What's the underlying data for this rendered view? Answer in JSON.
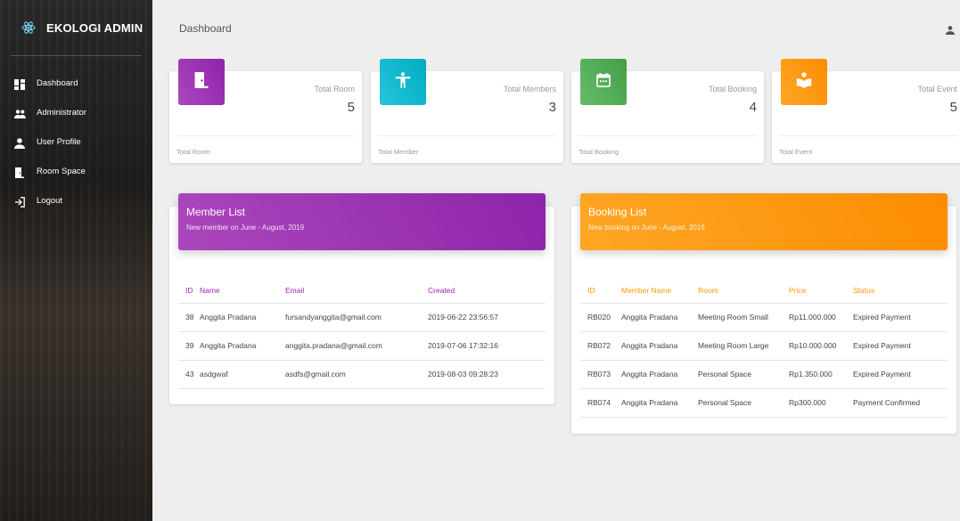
{
  "brand": {
    "title": "EKOLOGI ADMIN",
    "logo_icon": "atom-icon",
    "color": "#7fd6ff"
  },
  "sidebar": {
    "items": [
      {
        "label": "Dashboard",
        "icon": "dashboard-icon"
      },
      {
        "label": "Administrator",
        "icon": "people-icon"
      },
      {
        "label": "User Profile",
        "icon": "person-icon"
      },
      {
        "label": "Room Space",
        "icon": "door-icon"
      },
      {
        "label": "Logout",
        "icon": "logout-icon"
      }
    ]
  },
  "header": {
    "title": "Dashboard",
    "user_icon": "person-icon"
  },
  "stats": [
    {
      "category": "Total Room",
      "value": "5",
      "footer": "Total Room",
      "color": "#ab47bc",
      "icon": "door-icon"
    },
    {
      "category": "Total Members",
      "value": "3",
      "footer": "Total Member",
      "color": "#26c6da",
      "icon": "person-standing-icon"
    },
    {
      "category": "Total Booking",
      "value": "4",
      "footer": "Total Booking",
      "color": "#66bb6a",
      "icon": "calendar-icon"
    },
    {
      "category": "Total Event",
      "value": "5",
      "footer": "Total Event",
      "color": "#ffa726",
      "icon": "book-icon"
    }
  ],
  "member_list": {
    "title": "Member List",
    "subtitle": "New member on June - August, 2019",
    "color": "#ab47bc",
    "columns": {
      "id": "ID",
      "name": "Name",
      "email": "Email",
      "created": "Created"
    },
    "rows": [
      {
        "id": "38",
        "name": "Anggita Pradana",
        "email": "fursandyanggita@gmail.com",
        "created": "2019-06-22 23:56:57"
      },
      {
        "id": "39",
        "name": "Anggita Pradana",
        "email": "anggita.pradana@gmail.com",
        "created": "2019-07-06 17:32:16"
      },
      {
        "id": "43",
        "name": "asdgwaf",
        "email": "asdfs@gmail.com",
        "created": "2019-08-03 09:28:23"
      }
    ]
  },
  "booking_list": {
    "title": "Booking List",
    "subtitle": "New booking on June - August, 2019",
    "color": "#ffa726",
    "columns": {
      "id": "ID",
      "member": "Member Name",
      "room": "Room",
      "price": "Price",
      "status": "Status"
    },
    "rows": [
      {
        "id": "RB020",
        "member": "Anggita Pradana",
        "room": "Meeting Room Small",
        "price": "Rp11.000.000",
        "status": "Expired Payment"
      },
      {
        "id": "RB072",
        "member": "Anggita Pradana",
        "room": "Meeting Room Large",
        "price": "Rp10.000.000",
        "status": "Expired Payment"
      },
      {
        "id": "RB073",
        "member": "Anggita Pradana",
        "room": "Personal Space",
        "price": "Rp1.350.000",
        "status": "Expired Payment"
      },
      {
        "id": "RB074",
        "member": "Anggita Pradana",
        "room": "Personal Space",
        "price": "Rp300.000",
        "status": "Payment Confirmed"
      }
    ]
  }
}
